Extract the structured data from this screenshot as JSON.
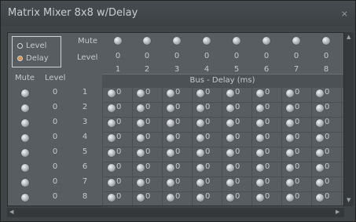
{
  "window": {
    "title": "Matrix Mixer 8x8 w/Delay",
    "close_glyph": "×"
  },
  "mode": {
    "options": [
      "Level",
      "Delay"
    ],
    "selected": "Delay"
  },
  "header": {
    "mute_label": "Mute",
    "level_label": "Level",
    "bus_title": "Bus - Delay (ms)"
  },
  "left_header": {
    "mute": "Mute",
    "level": "Level"
  },
  "bus_columns": [
    {
      "level": "0",
      "number": "1"
    },
    {
      "level": "0",
      "number": "2"
    },
    {
      "level": "0",
      "number": "3"
    },
    {
      "level": "0",
      "number": "4"
    },
    {
      "level": "0",
      "number": "5"
    },
    {
      "level": "0",
      "number": "6"
    },
    {
      "level": "0",
      "number": "7"
    },
    {
      "level": "0",
      "number": "8"
    }
  ],
  "input_rows": [
    {
      "level": "0",
      "number": "1",
      "delays": [
        "0",
        "0",
        "0",
        "0",
        "0",
        "0",
        "0",
        "0"
      ]
    },
    {
      "level": "0",
      "number": "2",
      "delays": [
        "0",
        "0",
        "0",
        "0",
        "0",
        "0",
        "0",
        "0"
      ]
    },
    {
      "level": "0",
      "number": "3",
      "delays": [
        "0",
        "0",
        "0",
        "0",
        "0",
        "0",
        "0",
        "0"
      ]
    },
    {
      "level": "0",
      "number": "4",
      "delays": [
        "0",
        "0",
        "0",
        "0",
        "0",
        "0",
        "0",
        "0"
      ]
    },
    {
      "level": "0",
      "number": "5",
      "delays": [
        "0",
        "0",
        "0",
        "0",
        "0",
        "0",
        "0",
        "0"
      ]
    },
    {
      "level": "0",
      "number": "6",
      "delays": [
        "0",
        "0",
        "0",
        "0",
        "0",
        "0",
        "0",
        "0"
      ]
    },
    {
      "level": "0",
      "number": "7",
      "delays": [
        "0",
        "0",
        "0",
        "0",
        "0",
        "0",
        "0",
        "0"
      ]
    },
    {
      "level": "0",
      "number": "8",
      "delays": [
        "0",
        "0",
        "0",
        "0",
        "0",
        "0",
        "0",
        "0"
      ]
    }
  ],
  "colors": {
    "accent": "#e69a4a",
    "panel": "#585d61",
    "window": "#3f4447"
  }
}
